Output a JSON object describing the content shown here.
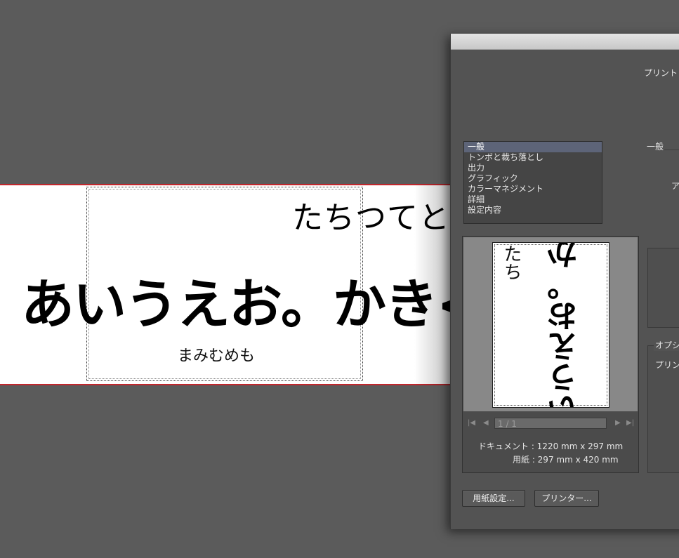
{
  "artboard": {
    "top_text": "たちつてと",
    "big_text": "あいうえお。かき<",
    "small_text": "まみむめも"
  },
  "dialog": {
    "header_label": "プリント",
    "categories": [
      {
        "label": "一般"
      },
      {
        "label": "トンボと裁ち落とし"
      },
      {
        "label": "出力"
      },
      {
        "label": "グラフィック"
      },
      {
        "label": "カラーマネジメント"
      },
      {
        "label": "詳細"
      },
      {
        "label": "設定内容"
      }
    ],
    "section_general": "一般",
    "right_partial_label": "ア",
    "options_label": "オプシ",
    "options_sub_label": "プリン",
    "preview": {
      "vertical_small": "たち",
      "vertical_big": "いうえお。か",
      "page_indicator": "1 / 1",
      "document_size": "ドキュメント : 1220 mm x 297 mm",
      "paper_size": "用紙 : 297 mm x 420 mm"
    },
    "buttons": {
      "page_setup": "用紙設定...",
      "printer": "プリンター..."
    }
  }
}
